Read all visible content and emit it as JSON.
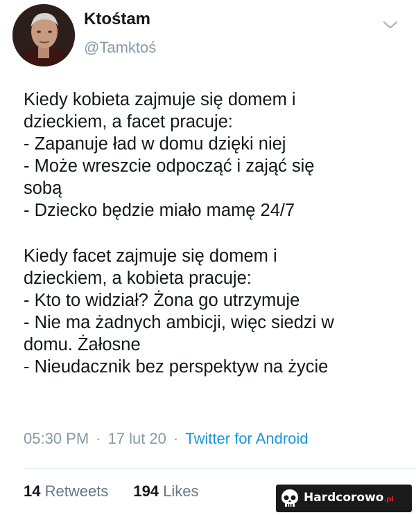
{
  "author": {
    "name": "Ktośtam",
    "handle": "@Tamktoś",
    "avatar_icon": "avatar-photo"
  },
  "tweet": {
    "lines": [
      "Kiedy kobieta zajmuje się domem i",
      "dzieckiem, a facet pracuje:",
      "- Zapanuje ład w domu dzięki niej",
      "- Może wreszcie odpocząć i zająć się",
      "sobą",
      "- Dziecko będzie miało mamę 24/7",
      "",
      "Kiedy facet zajmuje się domem i",
      "dzieckiem, a kobieta pracuje:",
      "- Kto to widział? Żona go utrzymuje",
      "- Nie ma żadnych ambicji, więc siedzi w",
      "domu. Żałosne",
      "- Nieudacznik bez perspektyw na życie"
    ]
  },
  "meta": {
    "time": "05:30 PM",
    "date": "17 lut 20",
    "separator": "·",
    "source": "Twitter for Android"
  },
  "stats": {
    "retweets_count": "14",
    "retweets_label": "Retweets",
    "likes_count": "194",
    "likes_label": "Likes"
  },
  "watermark": {
    "name": "Hardcorowo",
    "tld": ".pl"
  },
  "colors": {
    "text": "#14171a",
    "muted": "#8899a6",
    "link": "#1b95e0",
    "divider": "#e1e8ed"
  }
}
